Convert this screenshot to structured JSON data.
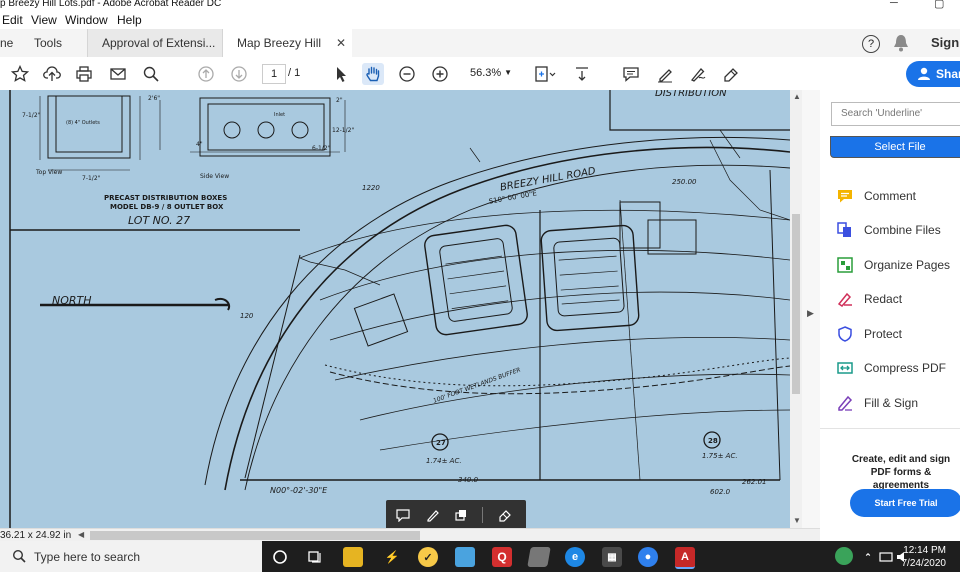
{
  "window": {
    "title": "p Breezy Hill Lots.pdf - Adobe Acrobat Reader DC"
  },
  "menu": {
    "items": [
      "Edit",
      "View",
      "Window",
      "Help"
    ]
  },
  "tabs": {
    "home": "ne",
    "tools": "Tools",
    "doc1": "Approval of Extensi...",
    "doc2": "Map Breezy Hill Lots...",
    "sign_in": "Sign"
  },
  "toolbar": {
    "page_current": "1",
    "page_total": "/ 1",
    "zoom": "56.3%",
    "share": "Shar"
  },
  "document": {
    "labels": {
      "distribution": "DISTRIBUTION",
      "outlets": "(8) 4\" Outlets",
      "top_view": "Top View",
      "side_view": "Side View",
      "inlet": "Inlet",
      "precast1": "PRECAST DISTRIBUTION BOXES",
      "precast2": "MODEL DB-9 / 8 OUTLET BOX",
      "lot": "LOT NO. 27",
      "north": "NORTH",
      "road": "BREEZY HILL ROAD",
      "bearing": "S10° 00' 00\"E",
      "lot27": "27",
      "lot28": "28",
      "area27": "1.74± AC.",
      "area28": "1.75± AC.",
      "south_bearing": "N00°-02'-30\"E",
      "d340": "340.0",
      "d602": "602.0",
      "d262": "262.01",
      "d250": "250.00",
      "d120": "120",
      "d1220": "1220",
      "buffer": "100' FOOT WETLANDS BUFFER",
      "dims": [
        "7-1/2\"",
        "2'6\"",
        "2\"",
        "12-1/2\"",
        "6-1/2\"",
        "4\"",
        "7-1/2\""
      ]
    },
    "page_size": "36.21 x 24.92 in"
  },
  "right_panel": {
    "search_placeholder": "Search 'Underline'",
    "select_file": "Select File",
    "tools": [
      "Comment",
      "Combine Files",
      "Organize Pages",
      "Redact",
      "Protect",
      "Compress PDF",
      "Fill & Sign"
    ],
    "promo_text": "Create, edit and sign PDF forms & agreements",
    "promo_button": "Start Free Trial"
  },
  "taskbar": {
    "search_label": "Type here to search",
    "time": "12:14 PM",
    "date": "7/24/2020"
  },
  "colors": {
    "accent": "#1a73e8",
    "doc_bg": "#a9c9df",
    "taskbar": "#1e1e1e"
  }
}
